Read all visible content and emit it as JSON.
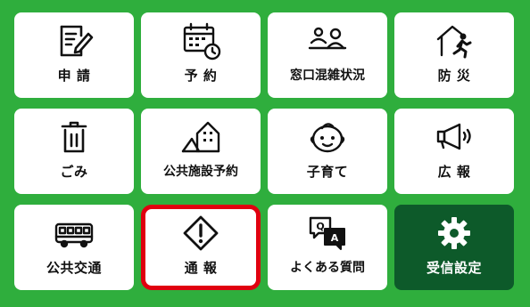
{
  "tiles": {
    "application": {
      "label": "申 請",
      "icon": "document-pen-icon"
    },
    "reservation": {
      "label": "予 約",
      "icon": "calendar-clock-icon"
    },
    "counter_congestion": {
      "label": "窓口混雑状況",
      "icon": "people-counter-icon"
    },
    "disaster_prevention": {
      "label": "防 災",
      "icon": "evacuation-icon"
    },
    "garbage": {
      "label": "ごみ",
      "icon": "trash-can-icon"
    },
    "facility_reservation": {
      "label": "公共施設予約",
      "icon": "facility-icon"
    },
    "child_rearing": {
      "label": "子育て",
      "icon": "baby-face-icon"
    },
    "public_relations": {
      "label": "広 報",
      "icon": "megaphone-icon"
    },
    "public_transport": {
      "label": "公共交通",
      "icon": "bus-icon"
    },
    "report": {
      "label": "通 報",
      "icon": "warning-diamond-icon"
    },
    "faq": {
      "label": "よくある質問",
      "icon": "qa-bubbles-icon"
    },
    "reception_settings": {
      "label": "受信設定",
      "icon": "gear-icon"
    }
  },
  "colors": {
    "background": "#2fae3d",
    "tile": "#ffffff",
    "dark_tile": "#0d5a2a",
    "highlight_border": "#e0000f"
  }
}
